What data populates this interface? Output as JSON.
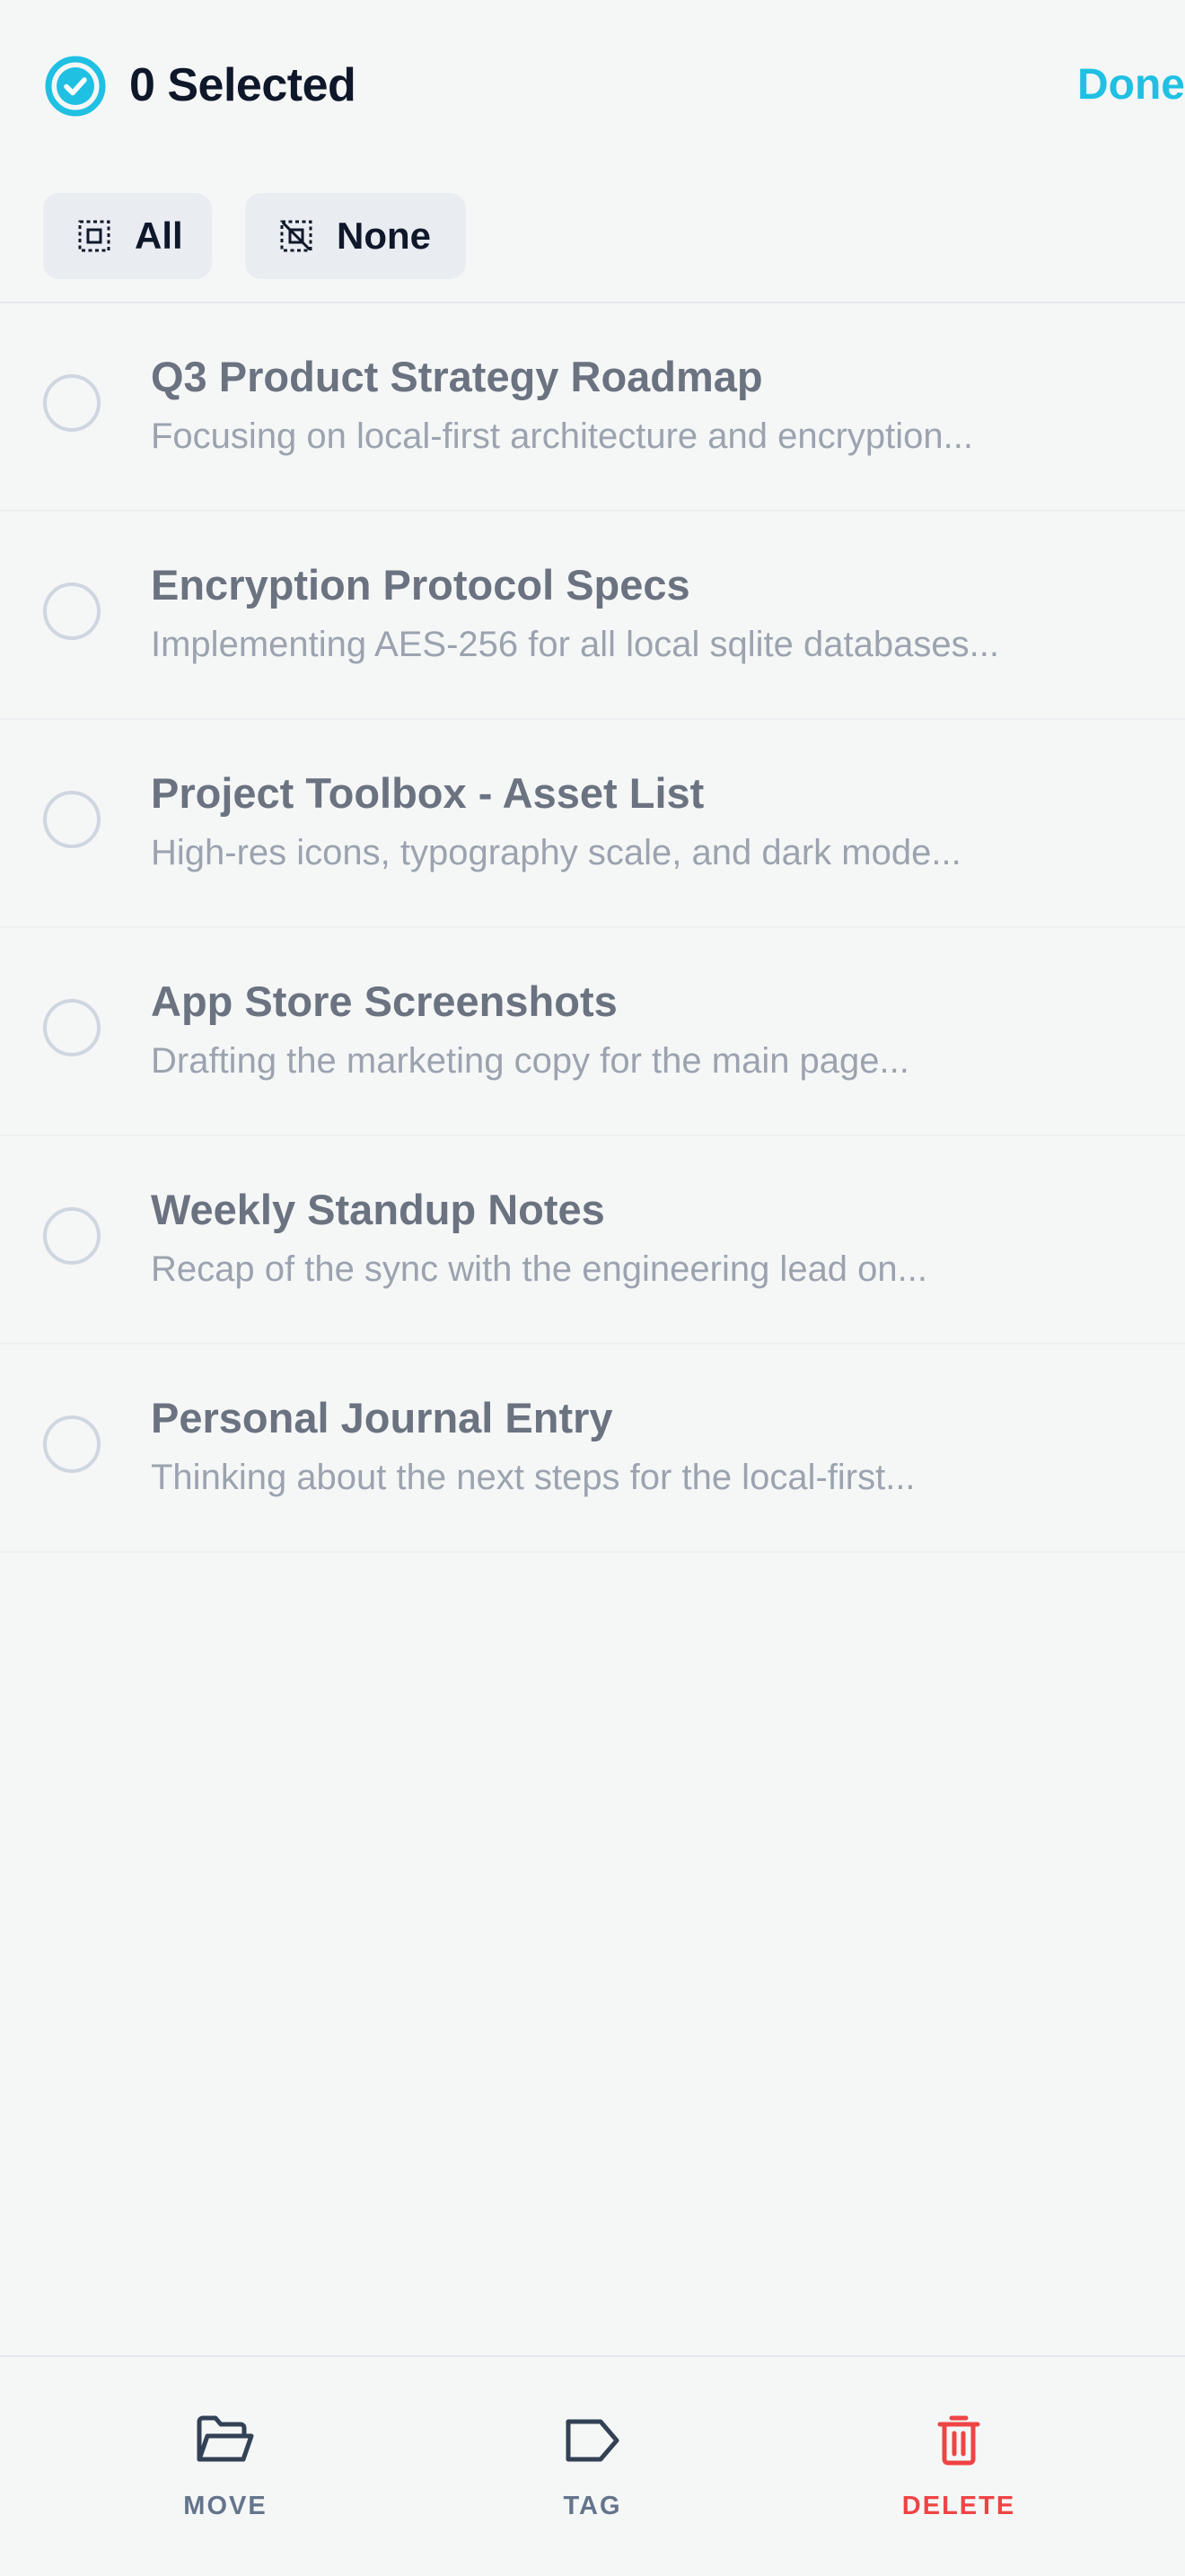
{
  "header": {
    "selected_title": "0 Selected",
    "done_label": "Done",
    "icon": "check-circle-icon",
    "accent_color": "#1fc0e2"
  },
  "selection_chips": {
    "all_label": "All",
    "all_icon": "select-all-icon",
    "none_label": "None",
    "none_icon": "deselect-icon"
  },
  "notes": [
    {
      "title": "Q3 Product Strategy Roadmap",
      "preview": "Focusing on local-first architecture and encryption...",
      "selected": false
    },
    {
      "title": "Encryption Protocol Specs",
      "preview": "Implementing AES-256 for all local sqlite databases...",
      "selected": false
    },
    {
      "title": "Project Toolbox - Asset List",
      "preview": "High-res icons, typography scale, and dark mode...",
      "selected": false
    },
    {
      "title": "App Store Screenshots",
      "preview": "Drafting the marketing copy for the main page...",
      "selected": false
    },
    {
      "title": "Weekly Standup Notes",
      "preview": "Recap of the sync with the engineering lead on...",
      "selected": false
    },
    {
      "title": "Personal Journal Entry",
      "preview": "Thinking about the next steps for the local-first...",
      "selected": false
    }
  ],
  "bottom_actions": {
    "move_label": "MOVE",
    "move_icon": "folder-open-icon",
    "tag_label": "TAG",
    "tag_icon": "tag-icon",
    "delete_label": "DELETE",
    "delete_icon": "trash-icon",
    "delete_color": "#ef4444"
  }
}
